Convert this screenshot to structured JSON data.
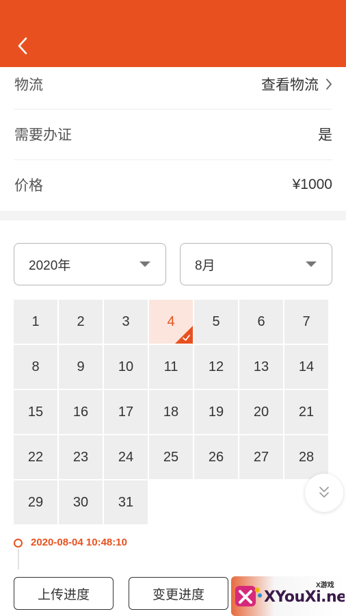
{
  "header": {
    "back_icon": "chevron-left-icon"
  },
  "info": {
    "logistics": {
      "label": "物流",
      "value": "查看物流"
    },
    "certificate": {
      "label": "需要办证",
      "value": "是"
    },
    "price": {
      "label": "价格",
      "value": "¥1000"
    }
  },
  "calendar": {
    "year": "2020年",
    "month": "8月",
    "selected_day": 4,
    "days": [
      "1",
      "2",
      "3",
      "4",
      "5",
      "6",
      "7",
      "8",
      "9",
      "10",
      "11",
      "12",
      "13",
      "14",
      "15",
      "16",
      "17",
      "18",
      "19",
      "20",
      "21",
      "22",
      "23",
      "24",
      "25",
      "26",
      "27",
      "28",
      "29",
      "30",
      "31"
    ]
  },
  "timeline": {
    "timestamp": "2020-08-04 10:48:10"
  },
  "actions": {
    "upload_label": "上传进度",
    "change_label": "变更进度"
  },
  "watermark": {
    "brand": "XYouXi.net",
    "tag": "X游戏"
  },
  "colors": {
    "accent": "#e8511f",
    "selected_bg": "#fce5dc",
    "cell_bg": "#eeeeee"
  }
}
